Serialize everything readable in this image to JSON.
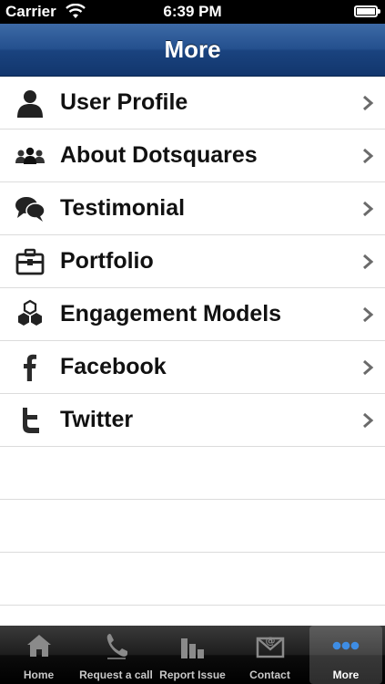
{
  "status_bar": {
    "carrier": "Carrier",
    "time": "6:39 PM"
  },
  "nav": {
    "title": "More"
  },
  "menu": {
    "items": [
      {
        "label": "User Profile",
        "icon": "user-icon"
      },
      {
        "label": "About Dotsquares",
        "icon": "group-icon"
      },
      {
        "label": "Testimonial",
        "icon": "chat-bubbles-icon"
      },
      {
        "label": "Portfolio",
        "icon": "briefcase-icon"
      },
      {
        "label": "Engagement Models",
        "icon": "hexagons-icon"
      },
      {
        "label": "Facebook",
        "icon": "facebook-icon"
      },
      {
        "label": "Twitter",
        "icon": "twitter-icon"
      }
    ]
  },
  "tabs": [
    {
      "label": "Home",
      "icon": "home-icon"
    },
    {
      "label": "Request a call",
      "icon": "phone-icon"
    },
    {
      "label": "Report Issue",
      "icon": "bar-chart-icon"
    },
    {
      "label": "Contact",
      "icon": "mail-icon"
    },
    {
      "label": "More",
      "icon": "more-dots-icon",
      "selected": true
    }
  ],
  "colors": {
    "nav_blue": "#24508e",
    "tab_highlight": "#3e8de4"
  }
}
